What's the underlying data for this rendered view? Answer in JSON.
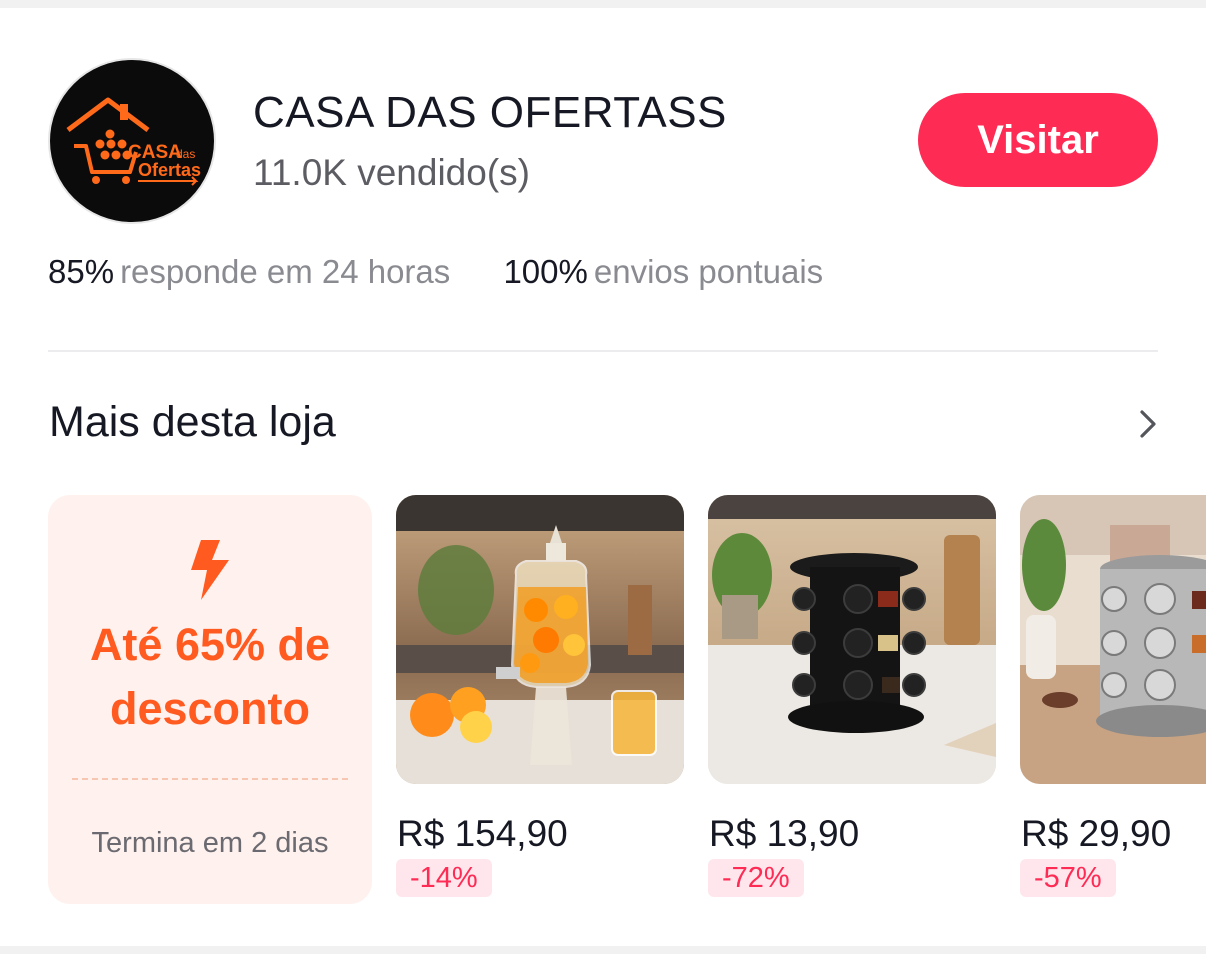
{
  "shop": {
    "name": "CASA DAS OFERTASS",
    "sold": "11.0K vendido(s)",
    "visit_label": "Visitar",
    "logo_text": [
      "CASA",
      "das",
      "Ofertas"
    ]
  },
  "stats": [
    {
      "value": "85%",
      "label": "responde em 24 horas"
    },
    {
      "value": "100%",
      "label": "envios pontuais"
    }
  ],
  "section": {
    "title": "Mais desta loja",
    "chevron_icon": "chevron-right-icon"
  },
  "promo": {
    "icon": "lightning-bolt-icon",
    "text_line1": "Até 65% de",
    "text_line2": "desconto",
    "ends": "Termina em 2 dias"
  },
  "products": [
    {
      "price": "R$ 154,90",
      "discount": "-14%",
      "image": "glass drink dispenser with oranges"
    },
    {
      "price": "R$ 13,90",
      "discount": "-72%",
      "image": "black rotating spice rack"
    },
    {
      "price": "R$ 29,90",
      "discount": "-57%",
      "image": "stainless rotating spice rack"
    }
  ],
  "colors": {
    "accent": "#fe2c55",
    "promo_orange": "#ff5a1f",
    "promo_bg": "#fff1ee",
    "badge_bg": "#ffe6ec"
  }
}
